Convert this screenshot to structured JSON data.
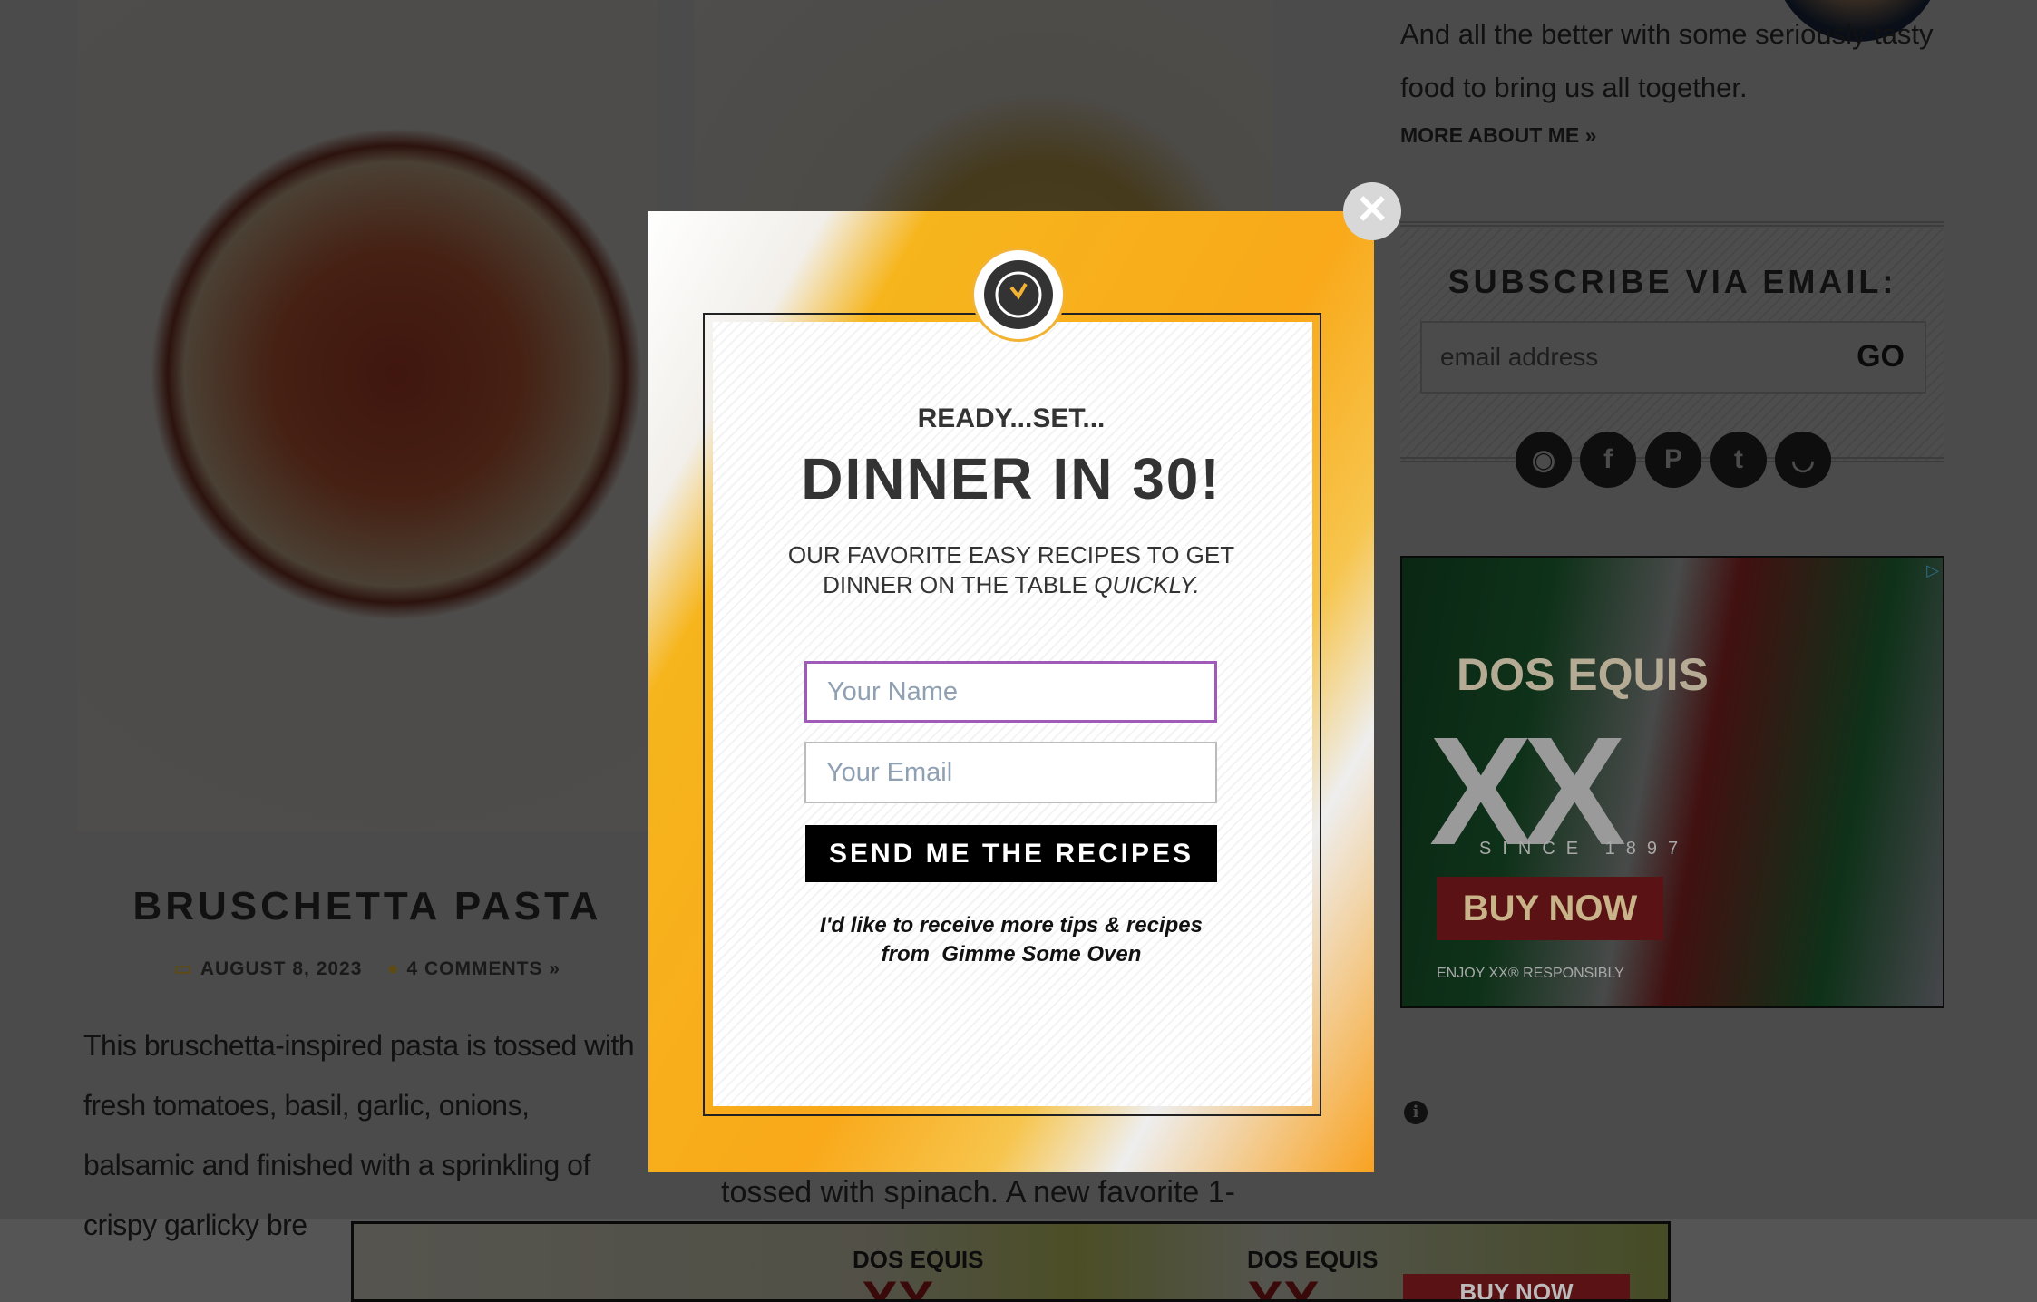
{
  "post": {
    "title": "BRUSCHETTA PASTA",
    "date": "AUGUST 8, 2023",
    "comments": "4 COMMENTS »",
    "body": "This bruschetta-inspired pasta is tossed with fresh tomatoes, basil, garlic, onions, balsamic and finished with a sprinkling of crispy garlicky bre"
  },
  "post2": {
    "body_fragment": "tossed with spinach. A new favorite 1-"
  },
  "sidebar": {
    "about_text": "And all the better with some seriously tasty food to bring us all together.",
    "more_link": "MORE ABOUT ME »",
    "subscribe_title": "SUBSCRIBE VIA EMAIL:",
    "email_placeholder": "email address",
    "go_label": "GO",
    "social": [
      {
        "icon": "rss-icon",
        "glyph": "◉"
      },
      {
        "icon": "facebook-icon",
        "glyph": "f"
      },
      {
        "icon": "pinterest-icon",
        "glyph": "P"
      },
      {
        "icon": "twitter-icon",
        "glyph": "t"
      },
      {
        "icon": "instagram-icon",
        "glyph": "◡"
      }
    ]
  },
  "ad": {
    "brand": "DOS EQUIS",
    "logo": "XX",
    "since": "SINCE 1897",
    "cta": "BUY NOW",
    "disclaimer": "ENJOY XX® RESPONSIBLY",
    "info_glyph": "i",
    "choice_glyph": "▷"
  },
  "bottom_ad": {
    "brand": "DOS EQUIS",
    "logo": "XX",
    "cta": "BUY NOW"
  },
  "modal": {
    "pre_title": "READY...SET...",
    "title": "DINNER IN 30!",
    "subtitle_line1": "OUR FAVORITE EASY RECIPES TO GET",
    "subtitle_line2": "DINNER ON THE TABLE ",
    "subtitle_emph": "QUICKLY.",
    "name_placeholder": "Your Name",
    "email_placeholder": "Your Email",
    "button_label": "SEND ME THE RECIPES",
    "disclaimer_line1": "I'd like to receive more tips & recipes",
    "disclaimer_line2": "from  Gimme Some Oven",
    "close_glyph": "✕",
    "accent_color": "#f2b233",
    "focus_color": "#a05ab8"
  }
}
